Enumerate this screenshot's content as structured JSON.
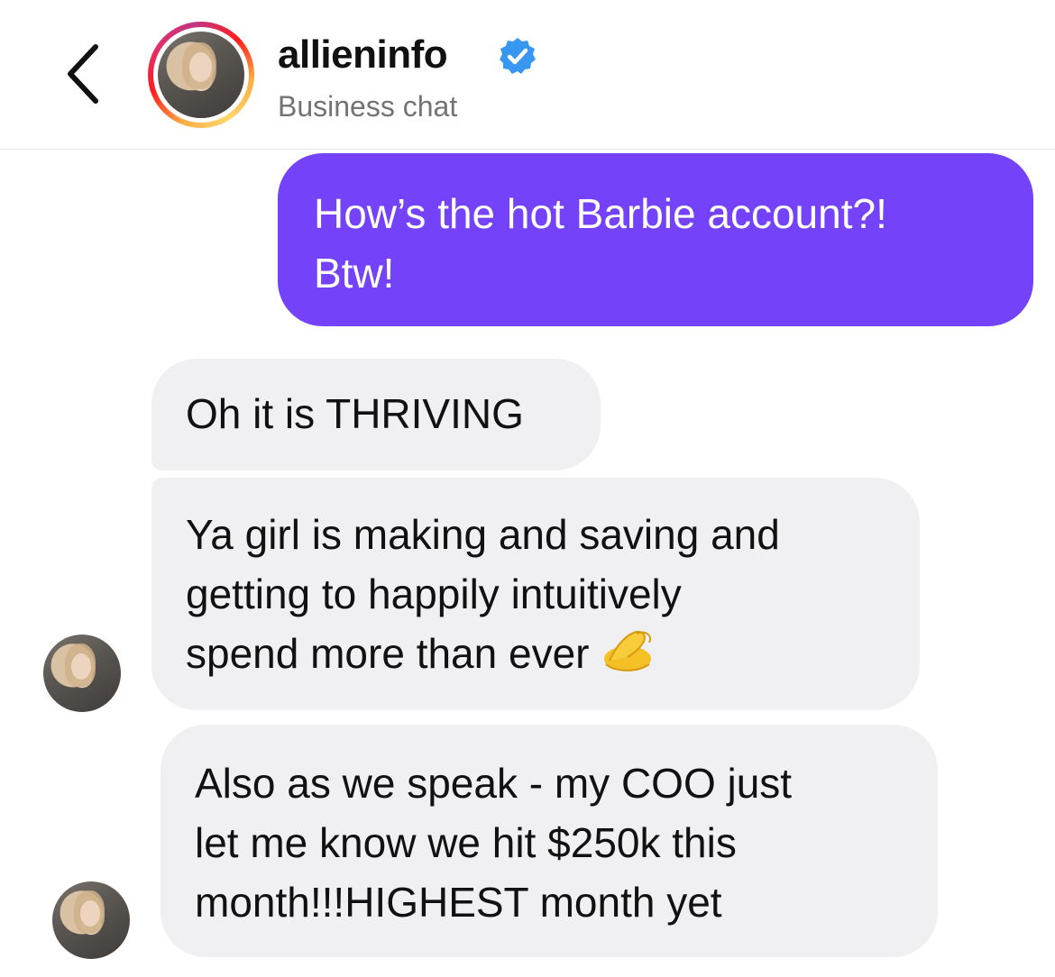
{
  "header": {
    "title": "allieninfo",
    "subtitle": "Business chat",
    "verified": true
  },
  "messages": [
    {
      "direction": "sent",
      "lines": [
        "How’s the hot Barbie account?!",
        "Btw!"
      ]
    },
    {
      "direction": "received",
      "lines": [
        "Oh it is THRIVING"
      ]
    },
    {
      "direction": "received",
      "lines": [
        "Ya girl is making and saving and",
        "getting to happily intuitively",
        "spend more than ever"
      ],
      "emoji": "pinched-fingers-emoji"
    },
    {
      "direction": "received",
      "lines": [
        "Also as we speak - my COO just",
        "let me know we hit $250k this",
        "month!!!HIGHEST month yet"
      ]
    }
  ],
  "colors": {
    "sent_bubble": "#7442f8",
    "received_bubble": "#f0f0f2",
    "verified_badge": "#3897f0",
    "subtitle": "#737373"
  }
}
